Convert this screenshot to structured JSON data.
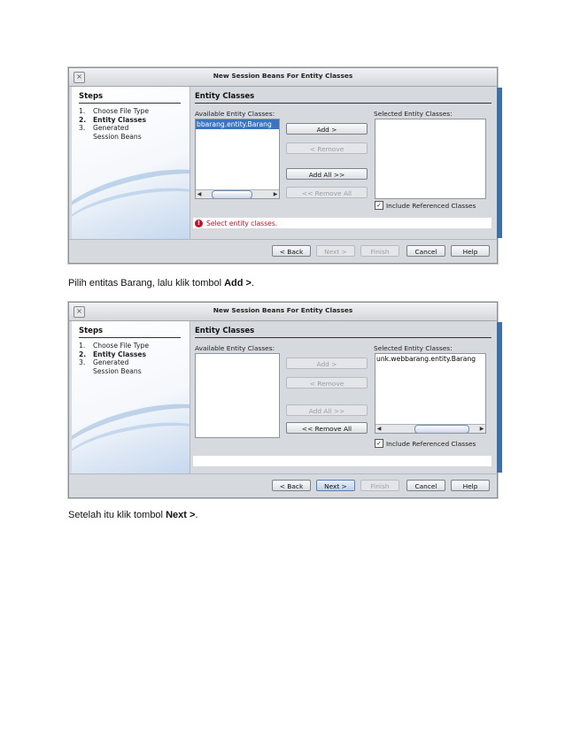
{
  "screenshots": [
    {
      "window_title": "New Session Beans For Entity Classes",
      "steps_heading": "Steps",
      "steps": [
        {
          "num": "1.",
          "label": "Choose File Type"
        },
        {
          "num": "2.",
          "label": "Entity Classes"
        },
        {
          "num": "3.",
          "label": "Generated Session Beans"
        }
      ],
      "panel_title": "Entity Classes",
      "available_label": "Available Entity Classes:",
      "selected_label": "Selected Entity Classes:",
      "available_items": [
        "bbarang.entity.Barang"
      ],
      "selected_items": [],
      "buttons": {
        "add": "Add >",
        "remove": "< Remove",
        "add_all": "Add All >>",
        "remove_all": "<< Remove All"
      },
      "include_referenced": "Include Referenced Classes",
      "message": "Select entity classes.",
      "footer": {
        "back": "< Back",
        "next": "Next >",
        "finish": "Finish",
        "cancel": "Cancel",
        "help": "Help"
      }
    },
    {
      "window_title": "New Session Beans For Entity Classes",
      "steps_heading": "Steps",
      "steps": [
        {
          "num": "1.",
          "label": "Choose File Type"
        },
        {
          "num": "2.",
          "label": "Entity Classes"
        },
        {
          "num": "3.",
          "label": "Generated Session Beans"
        }
      ],
      "panel_title": "Entity Classes",
      "available_label": "Available Entity Classes:",
      "selected_label": "Selected Entity Classes:",
      "available_items": [],
      "selected_items": [
        "unk.webbarang.entity.Barang"
      ],
      "buttons": {
        "add": "Add >",
        "remove": "< Remove",
        "add_all": "Add All >>",
        "remove_all": "<< Remove All"
      },
      "include_referenced": "Include Referenced Classes",
      "message": "",
      "footer": {
        "back": "< Back",
        "next": "Next >",
        "finish": "Finish",
        "cancel": "Cancel",
        "help": "Help"
      }
    }
  ],
  "captions": {
    "first_prefix": "Pilih entitas Barang, lalu klik tombol ",
    "first_bold": "Add >",
    "first_suffix": ".",
    "second_prefix": "Setelah itu klik tombol ",
    "second_bold": "Next >",
    "second_suffix": "."
  }
}
